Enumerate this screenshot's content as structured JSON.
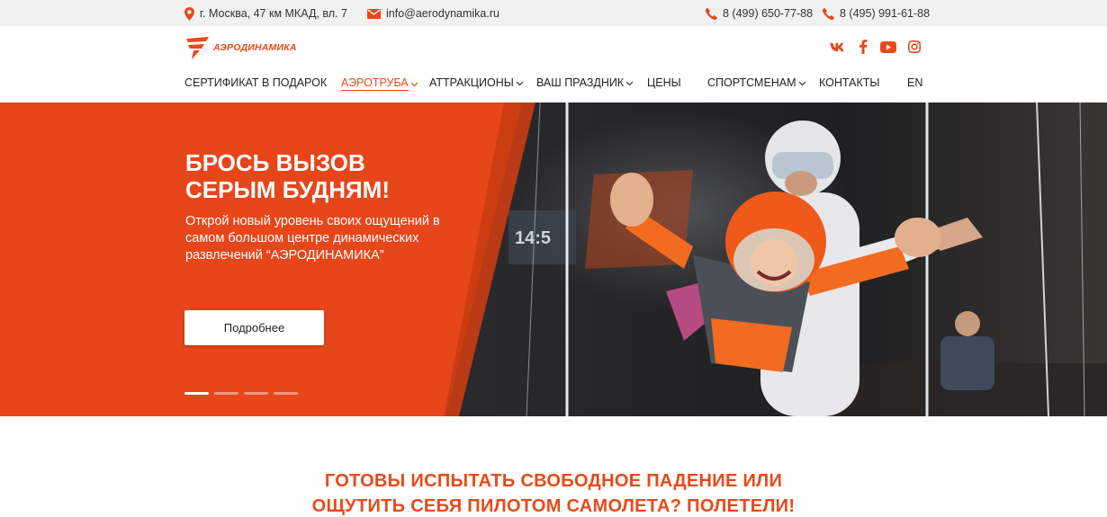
{
  "colors": {
    "accent": "#e64a19",
    "hero_bg": "#e6461a",
    "topbar_bg": "#f1f1f1"
  },
  "topbar": {
    "address": "г. Москва, 47 км МКАД, вл. 7",
    "email": "info@aerodynamika.ru",
    "phone1": "8 (499) 650-77-88",
    "phone2": "8 (495) 991-61-88",
    "icons": [
      "map-pin-icon",
      "mail-icon",
      "phone-icon",
      "phone-icon"
    ]
  },
  "header": {
    "logo_text": "АЭРОДИНАМИКА",
    "social": [
      "vk-icon",
      "facebook-icon",
      "youtube-icon",
      "instagram-icon"
    ]
  },
  "nav": {
    "items": [
      {
        "label": "СЕРТИФИКАТ В ПОДАРОК",
        "dropdown": false
      },
      {
        "label": "АЭРОТРУБА",
        "dropdown": true,
        "active": true
      },
      {
        "label": "АТТРАКЦИОНЫ",
        "dropdown": true
      },
      {
        "label": "ВАШ ПРАЗДНИК",
        "dropdown": true
      },
      {
        "label": "ЦЕНЫ",
        "dropdown": false
      },
      {
        "label": "СПОРТСМЕНАМ",
        "dropdown": true
      },
      {
        "label": "КОНТАКТЫ",
        "dropdown": false
      }
    ],
    "lang": "EN"
  },
  "hero": {
    "title_line1": "БРОСЬ ВЫЗОВ",
    "title_line2": "СЕРЫМ БУДНЯМ!",
    "text": "Открой новый уровень своих ощущений в самом большом центре динамических развлечений “АЭРОДИНАМИКА”",
    "button": "Подробнее",
    "screen_time": "14:5",
    "slides_total": 4,
    "slide_active": 1
  },
  "section": {
    "title_line1": "ГОТОВЫ ИСПЫТАТЬ СВОБОДНОЕ ПАДЕНИЕ ИЛИ",
    "title_line2": "ОЩУТИТЬ СЕБЯ ПИЛОТОМ САМОЛЕТА? ПОЛЕТЕЛИ!"
  }
}
